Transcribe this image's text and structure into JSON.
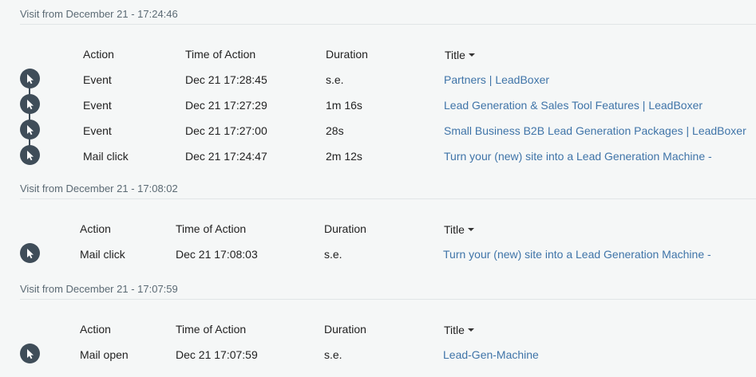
{
  "visits": [
    {
      "header": "Visit from December 21 - 17:24:46",
      "columns": {
        "action": "Action",
        "time": "Time of Action",
        "duration": "Duration",
        "title": "Title"
      },
      "rows": [
        {
          "action": "Event",
          "time": "Dec 21 17:28:45",
          "duration": "s.e.",
          "title": "Partners | LeadBoxer"
        },
        {
          "action": "Event",
          "time": "Dec 21 17:27:29",
          "duration": "1m 16s",
          "title": "Lead Generation & Sales Tool Features | LeadBoxer"
        },
        {
          "action": "Event",
          "time": "Dec 21 17:27:00",
          "duration": "28s",
          "title": "Small Business B2B Lead Generation Packages | LeadBoxer"
        },
        {
          "action": "Mail click",
          "time": "Dec 21 17:24:47",
          "duration": "2m 12s",
          "title": "Turn your (new) site into a Lead Generation Machine -"
        }
      ]
    },
    {
      "header": "Visit from December 21 - 17:08:02",
      "columns": {
        "action": "Action",
        "time": "Time of Action",
        "duration": "Duration",
        "title": "Title"
      },
      "rows": [
        {
          "action": "Mail click",
          "time": "Dec 21 17:08:03",
          "duration": "s.e.",
          "title": "Turn your (new) site into a Lead Generation Machine -"
        }
      ]
    },
    {
      "header": "Visit from December 21 - 17:07:59",
      "columns": {
        "action": "Action",
        "time": "Time of Action",
        "duration": "Duration",
        "title": "Title"
      },
      "rows": [
        {
          "action": "Mail open",
          "time": "Dec 21 17:07:59",
          "duration": "s.e.",
          "title": "Lead-Gen-Machine"
        }
      ]
    }
  ],
  "icons": {
    "row_icon": "cursor-icon",
    "sort_icon": "caret-down-icon"
  },
  "colors": {
    "link": "#3f74a8",
    "icon_bg": "#3f4d59",
    "header_text": "#5b6a74",
    "background": "#f5f7f7"
  }
}
